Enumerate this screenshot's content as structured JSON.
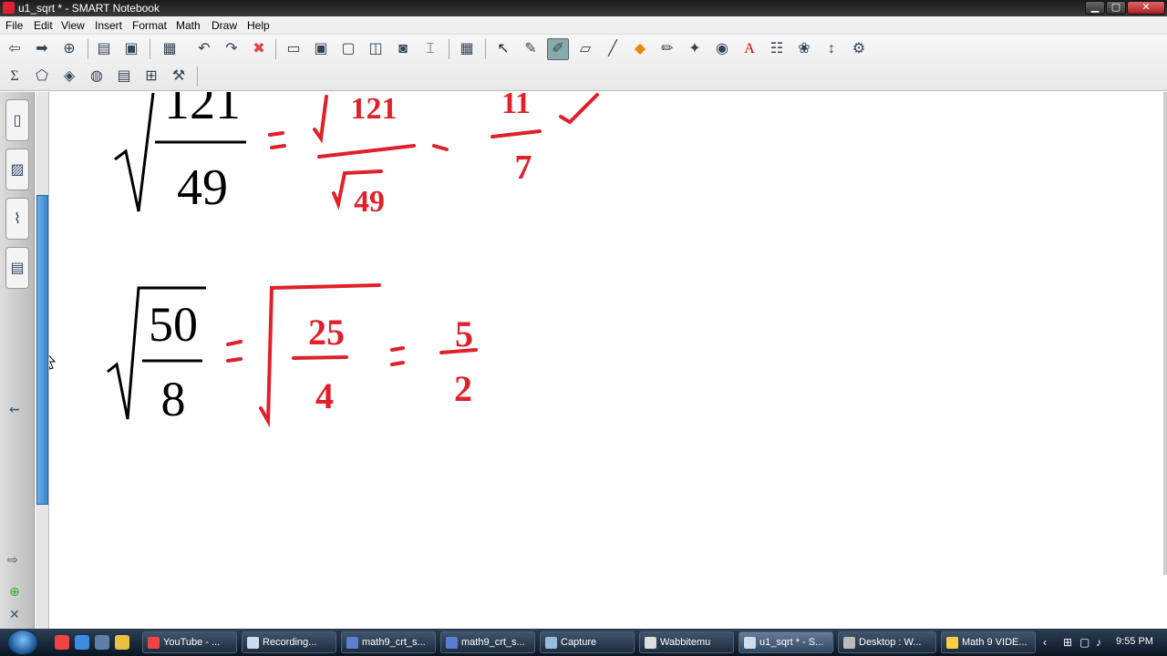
{
  "window": {
    "title": "u1_sqrt * - SMART Notebook"
  },
  "menu": [
    "File",
    "Edit",
    "View",
    "Insert",
    "Format",
    "Math",
    "Draw",
    "Help"
  ],
  "toolbar": {
    "row1": [
      "back-icon",
      "forward-icon",
      "add-page-icon",
      "open-icon",
      "save-icon",
      "paste-icon",
      "undo-icon",
      "redo-icon",
      "delete-icon",
      "screen-shade-icon",
      "full-screen-icon",
      "transparent-background-icon",
      "dual-page-icon",
      "capture-icon",
      "document-camera-icon",
      "table-icon",
      "select-icon",
      "pen-icon",
      "creative-pen-icon",
      "eraser-icon",
      "line-icon",
      "shape-icon",
      "magic-pen-icon",
      "highlighter-icon",
      "fill-icon",
      "text-icon",
      "properties-icon",
      "recognize-icon",
      "move-toolbar-icon",
      "customize-icon"
    ],
    "row2": [
      "sigma-icon",
      "geometry-icon",
      "ruler-icon",
      "protractor-icon",
      "table-tool-icon",
      "graph-icon",
      "tools-icon"
    ]
  },
  "math": {
    "expr1": {
      "numerator": "121",
      "denominator": "49"
    },
    "handwritten1": {
      "num": "121",
      "den": "49",
      "result_num": "11",
      "result_den": "7",
      "check": "✓"
    },
    "expr2": {
      "numerator": "50",
      "denominator": "8"
    },
    "handwritten2": {
      "inner_num": "25",
      "inner_den": "4",
      "result_num": "5",
      "result_den": "2"
    }
  },
  "taskbar": {
    "tasks": [
      {
        "label": "YouTube - ..."
      },
      {
        "label": "Recording..."
      },
      {
        "label": "math9_crt_s..."
      },
      {
        "label": "math9_crt_s..."
      },
      {
        "label": "Capture"
      },
      {
        "label": "Wabbitemu"
      },
      {
        "label": "u1_sqrt * - S..."
      },
      {
        "label": "Desktop : W..."
      },
      {
        "label": "Math 9 VIDE..."
      }
    ],
    "clock": "9:55 PM"
  },
  "colors": {
    "ink": "#e0202a",
    "accent": "#3c86cc",
    "taskbar": "#1b2a3b"
  }
}
